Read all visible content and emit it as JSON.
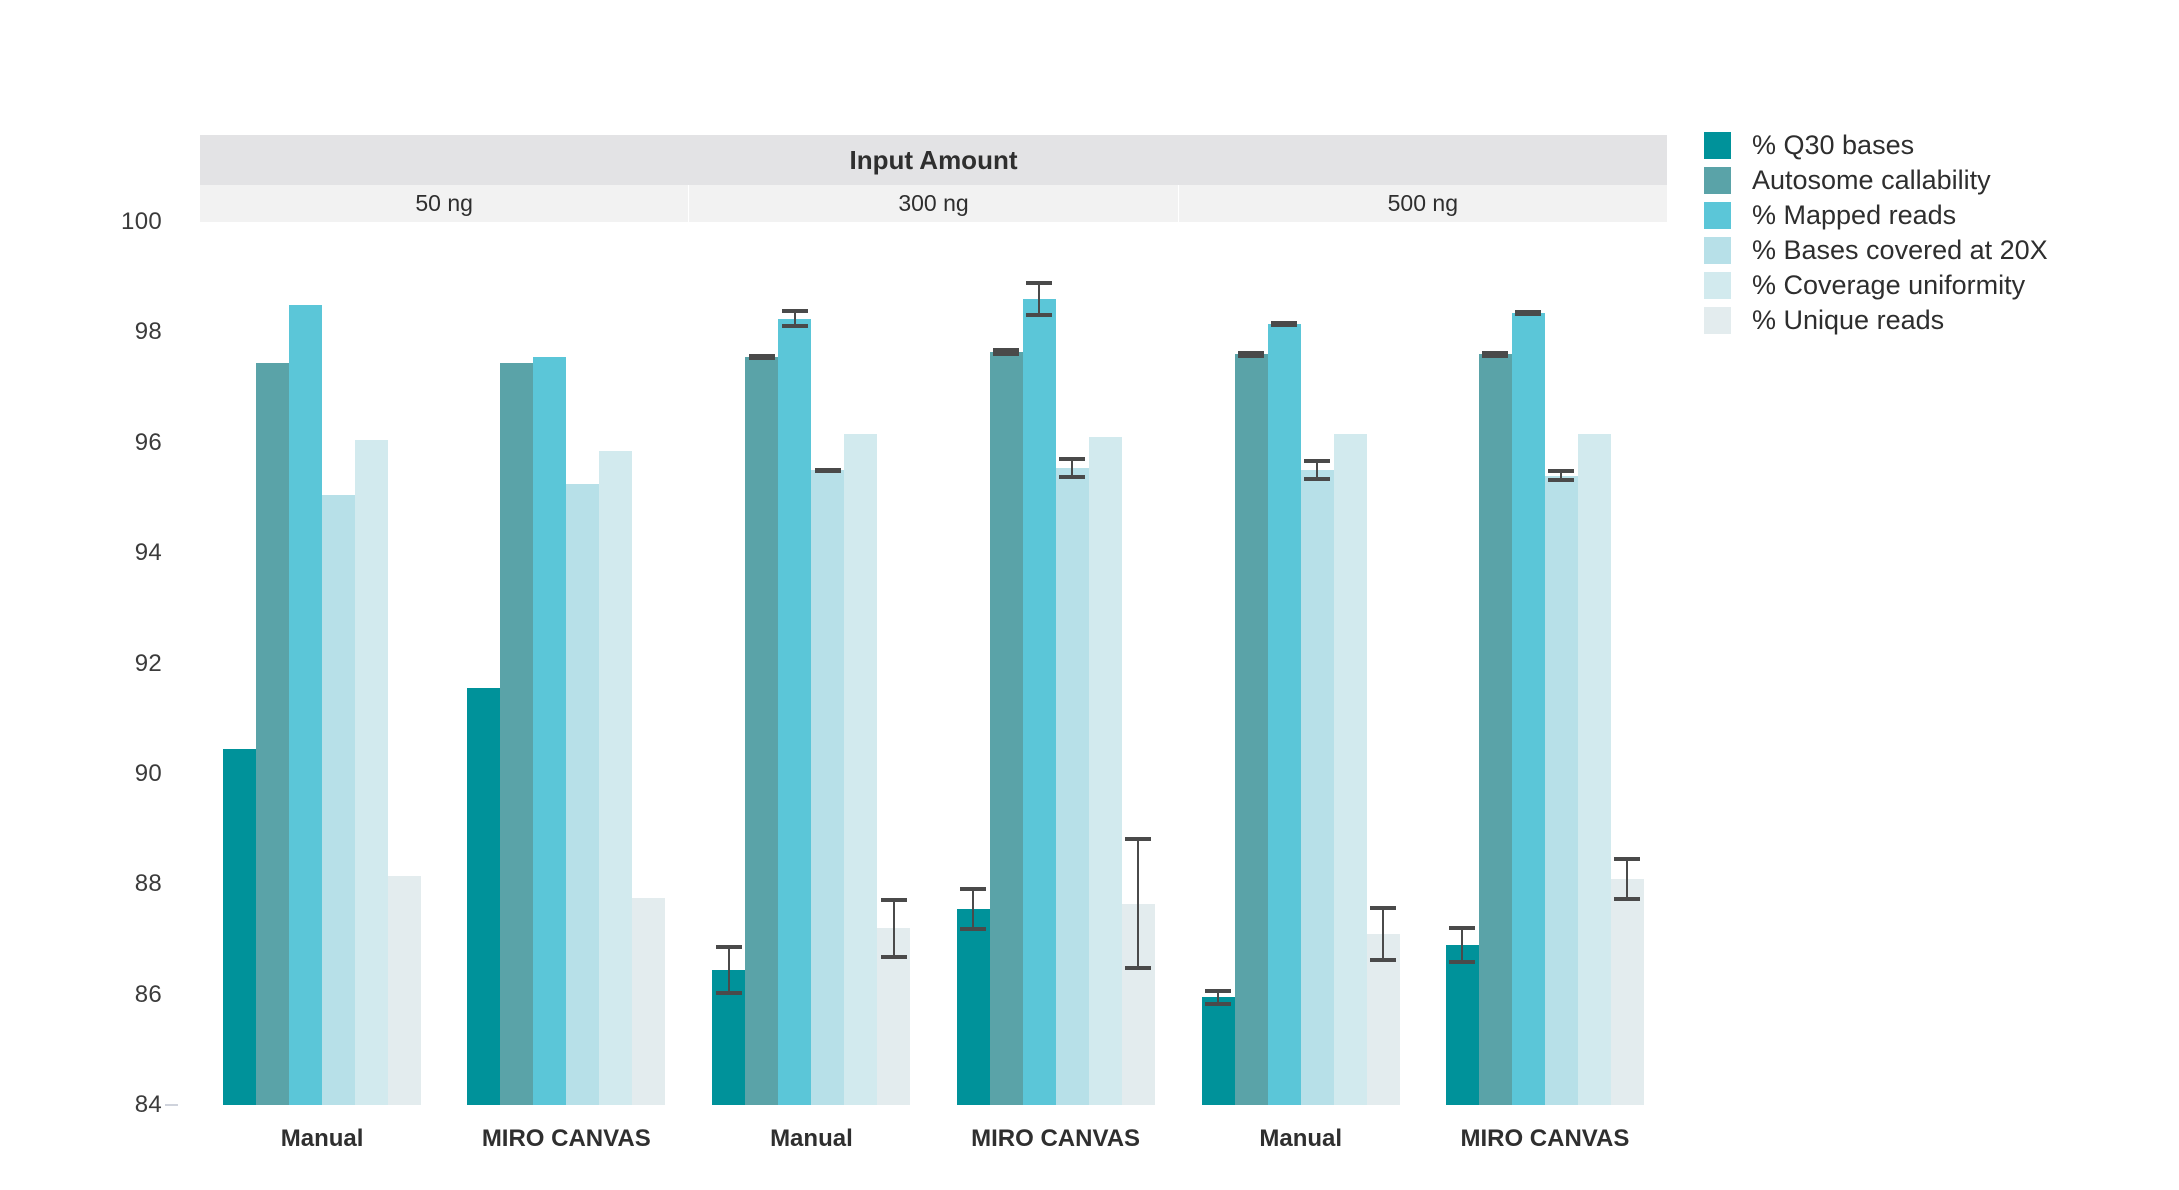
{
  "chart_data": {
    "type": "bar",
    "title": "Input Amount",
    "xlabel": "",
    "ylabel": "",
    "ylim": [
      84,
      100
    ],
    "yticks": [
      84,
      86,
      88,
      90,
      92,
      94,
      96,
      98,
      100
    ],
    "grid": false,
    "legend_position": "right",
    "facet_title": "Input Amount",
    "facets": [
      "50 ng",
      "300 ng",
      "500 ng"
    ],
    "categories": [
      "Manual",
      "MIRO CANVAS"
    ],
    "series": [
      {
        "name": "% Q30 bases",
        "color": "#00929a",
        "values": [
          90.45,
          91.55,
          86.45,
          87.55,
          85.95,
          86.9
        ],
        "errors": [
          0,
          0,
          0.45,
          0.4,
          0.15,
          0.35
        ]
      },
      {
        "name": "Autosome callability",
        "color": "#5aa3a8",
        "values": [
          97.45,
          97.45,
          97.55,
          97.65,
          97.6,
          97.6
        ],
        "errors": [
          0,
          0,
          0.05,
          0.07,
          0.07,
          0.07
        ]
      },
      {
        "name": "% Mapped reads",
        "color": "#5bc6d8",
        "values": [
          98.5,
          97.55,
          98.25,
          98.6,
          98.15,
          98.35
        ],
        "errors": [
          0,
          0,
          0.17,
          0.33,
          0.05,
          0.05
        ]
      },
      {
        "name": "% Bases covered at 20X",
        "color": "#b7e0e8",
        "values": [
          95.05,
          95.25,
          95.5,
          95.55,
          95.5,
          95.4
        ],
        "errors": [
          0,
          0,
          0.03,
          0.2,
          0.2,
          0.12
        ]
      },
      {
        "name": "% Coverage uniformity",
        "color": "#d2eaee",
        "values": [
          96.05,
          95.85,
          96.15,
          96.1,
          96.15,
          96.15
        ],
        "errors": [
          0,
          0,
          0,
          0,
          0,
          0
        ]
      },
      {
        "name": "% Unique reads",
        "color": "#e3ecee",
        "values": [
          88.15,
          87.75,
          87.2,
          87.65,
          87.1,
          88.1
        ],
        "errors": [
          0,
          0,
          0.55,
          1.2,
          0.5,
          0.4
        ]
      }
    ],
    "group_labels": [
      "Manual",
      "MIRO CANVAS",
      "Manual",
      "MIRO CANVAS",
      "Manual",
      "MIRO CANVAS"
    ]
  },
  "legend": {
    "items": [
      {
        "label": "% Q30 bases",
        "color": "#00929a"
      },
      {
        "label": "Autosome callability",
        "color": "#5aa3a8"
      },
      {
        "label": "% Mapped reads",
        "color": "#5bc6d8"
      },
      {
        "label": "% Bases covered at 20X",
        "color": "#b7e0e8"
      },
      {
        "label": "% Coverage uniformity",
        "color": "#d2eaee"
      },
      {
        "label": "% Unique reads",
        "color": "#e3ecee"
      }
    ]
  },
  "axes": {
    "y_tick_labels": [
      "100",
      "98",
      "96",
      "94",
      "92",
      "90",
      "88",
      "86",
      "84"
    ],
    "x_tick_labels": [
      "Manual",
      "MIRO CANVAS",
      "Manual",
      "MIRO CANVAS",
      "Manual",
      "MIRO CANVAS"
    ]
  },
  "strips": {
    "outer_label": "Input Amount",
    "inner_labels": [
      "50 ng",
      "300 ng",
      "500 ng"
    ]
  }
}
